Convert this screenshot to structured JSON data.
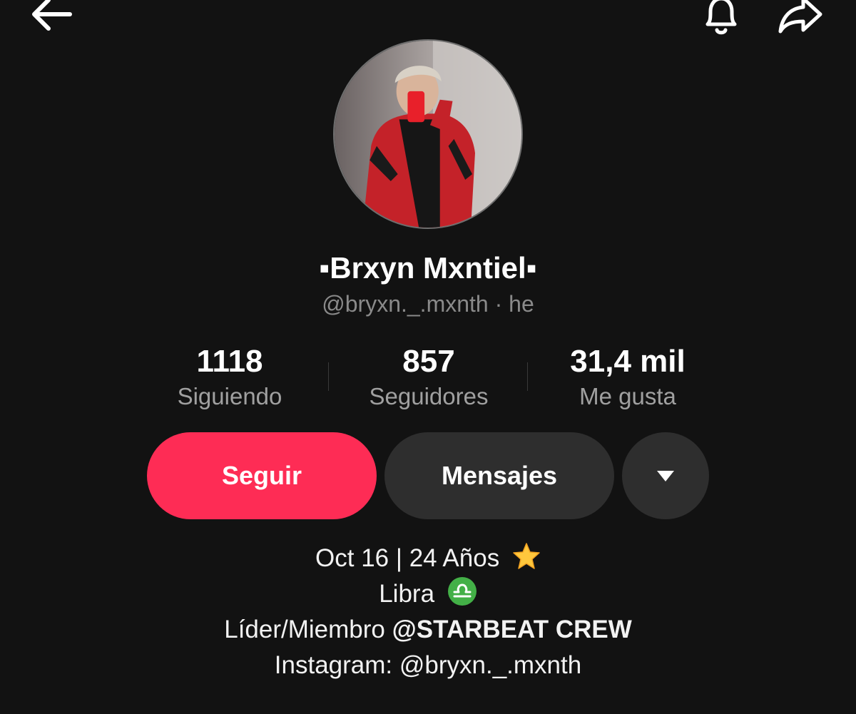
{
  "profile": {
    "display_name": "▪Brxyn Mxntiel▪",
    "handle": "@bryxn._.mxnth",
    "pronoun": "he",
    "separator": " · "
  },
  "stats": [
    {
      "value": "1118",
      "label": "Siguiendo"
    },
    {
      "value": "857",
      "label": "Seguidores"
    },
    {
      "value": "31,4 mil",
      "label": "Me gusta"
    }
  ],
  "actions": {
    "follow_label": "Seguir",
    "message_label": "Mensajes"
  },
  "bio": {
    "line1": "Oct 16 | 24 Años",
    "line1_emoji": "star-icon",
    "line2": "Libra",
    "line2_emoji": "libra-icon",
    "line3_prefix": "Líder/Miembro ",
    "line3_mention": "@STARBEAT CREW",
    "line4": "Instagram: @bryxn._.mxnth"
  },
  "colors": {
    "background": "#121212",
    "follow_button": "#fe2c55",
    "secondary_button": "#2e2e2e",
    "muted_text": "#8a8a8a"
  }
}
